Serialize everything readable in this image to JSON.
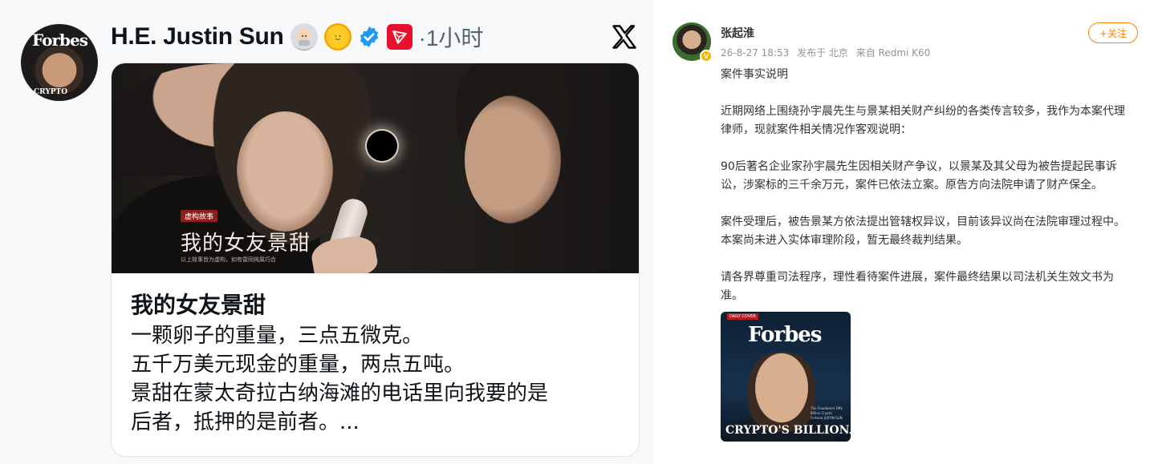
{
  "twitter": {
    "display_name": "H.E. Justin Sun",
    "avatar_text": "Forbes",
    "avatar_sub": "CRYPTO",
    "time": "·1小时",
    "card": {
      "poster_badge": "虚构故事",
      "poster_title": "我的女友景甜",
      "poster_note": "以上故事皆为虚构，如有雷同纯属巧合",
      "title": "我的女友景甜",
      "body": [
        "一颗卵子的重量，三点五微克。",
        "五千万美元现金的重量，两点五吨。",
        "景甜在蒙太奇拉古纳海滩的电话里向我要的是",
        "后者，抵押的是前者。..."
      ]
    },
    "icons": {
      "astronaut": "astronaut-emoji-icon",
      "sun": "sun-emoji-icon",
      "verified": "verified-badge-icon",
      "tron": "tron-logo-icon",
      "x": "x-logo-icon"
    },
    "colors": {
      "verified": "#1d9bf0",
      "tron": "#e8112d",
      "secondary_text": "#536471"
    }
  },
  "weibo": {
    "author": "张起淮",
    "badge_icon": "verified-v-badge-icon",
    "date": "26-8-27 18:53",
    "location": "发布于 北京",
    "source": "来自 Redmi K60",
    "follow_label": "+关注",
    "paragraphs": [
      [
        "案件事实说明"
      ],
      [
        "近期网络上围绕孙宇晨先生与景某相关财产纠纷的各类传言较多，我作为本案代理",
        "律师，现就案件相关情况作客观说明："
      ],
      [
        "90后著名企业家孙宇晨先生因相关财产争议，以景某及其父母为被告提起民事诉",
        "讼，涉案标的三千余万元，案件已依法立案。原告方向法院申请了财产保全。"
      ],
      [
        "案件受理后，被告景某方依法提出管辖权异议，目前该异议尚在法院审理过程中。",
        "本案尚未进入实体审理阶段，暂无最终裁判结果。"
      ],
      [
        "请各界尊重司法程序，理性看待案件进展，案件最终结果以司法机关生效文书为",
        "准。"
      ]
    ],
    "image": {
      "tag": "DAILY COVER",
      "masthead": "Forbes",
      "cover_line": "CRYPTO'S BILLIONAIRE BADBOY",
      "small_text": "The Fraudulent 1M$ Billion Crypto Fortune JUSTIN SUN"
    },
    "colors": {
      "follow": "#ff8200",
      "meta": "#939393"
    }
  }
}
